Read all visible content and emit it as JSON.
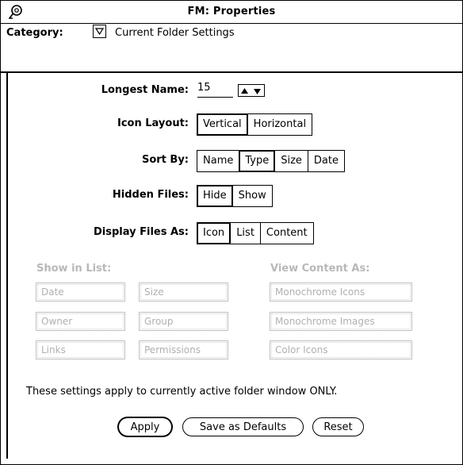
{
  "window": {
    "title": "FM: Properties"
  },
  "category": {
    "label": "Category:",
    "value": "Current Folder Settings"
  },
  "longest_name": {
    "label": "Longest Name:",
    "value": "15"
  },
  "icon_layout": {
    "label": "Icon Layout:",
    "options": [
      "Vertical",
      "Horizontal"
    ],
    "selected": "Vertical"
  },
  "sort_by": {
    "label": "Sort By:",
    "options": [
      "Name",
      "Type",
      "Size",
      "Date"
    ],
    "selected": "Type"
  },
  "hidden_files": {
    "label": "Hidden Files:",
    "options": [
      "Hide",
      "Show"
    ],
    "selected": "Hide"
  },
  "display_files_as": {
    "label": "Display Files As:",
    "options": [
      "Icon",
      "List",
      "Content"
    ],
    "selected": "Icon"
  },
  "show_in_list": {
    "label": "Show in List:",
    "items": [
      "Date",
      "Size",
      "Owner",
      "Group",
      "Links",
      "Permissions"
    ]
  },
  "view_content_as": {
    "label": "View Content As:",
    "items": [
      "Monochrome Icons",
      "Monochrome Images",
      "Color Icons"
    ]
  },
  "note": "These settings apply to currently active folder window ONLY.",
  "buttons": {
    "apply": "Apply",
    "save_defaults": "Save as Defaults",
    "reset": "Reset"
  }
}
